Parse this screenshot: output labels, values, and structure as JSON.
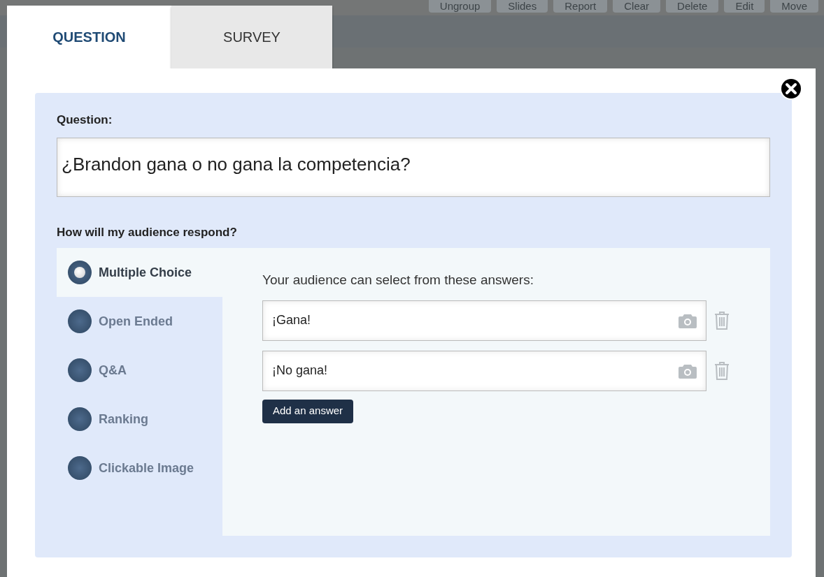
{
  "background_toolbar": [
    "Ungroup",
    "Slides",
    "Report",
    "Clear",
    "Delete",
    "Edit",
    "Move"
  ],
  "tabs": [
    {
      "label": "QUESTION",
      "selected": true
    },
    {
      "label": "SURVEY",
      "selected": false
    }
  ],
  "question": {
    "label": "Question:",
    "value": "¿Brandon gana o no gana la competencia?"
  },
  "response": {
    "label": "How will my audience respond?",
    "types": [
      {
        "label": "Multiple Choice",
        "selected": true
      },
      {
        "label": "Open Ended",
        "selected": false
      },
      {
        "label": "Q&A",
        "selected": false
      },
      {
        "label": "Ranking",
        "selected": false
      },
      {
        "label": "Clickable Image",
        "selected": false
      }
    ],
    "answers_intro": "Your audience can select from these answers:",
    "answers": [
      "¡Gana!",
      "¡No gana!"
    ],
    "add_button": "Add an answer"
  }
}
